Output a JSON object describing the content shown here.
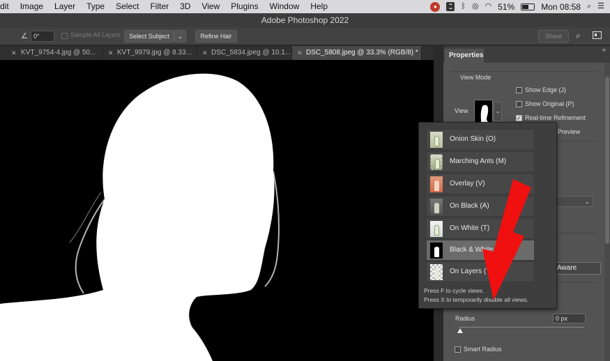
{
  "menubar": {
    "items": [
      "dit",
      "Image",
      "Layer",
      "Type",
      "Select",
      "Filter",
      "3D",
      "View",
      "Plugins",
      "Window",
      "Help"
    ],
    "battery": "51%",
    "clock": "Mon 08:58"
  },
  "title": "Adobe Photoshop 2022",
  "options_bar": {
    "angle_value": "0°",
    "sample_all_layers": "Sample All Layers",
    "select_subject": "Select Subject",
    "refine_hair": "Refine Hair",
    "share": "Share"
  },
  "tabs": [
    {
      "label": "KVT_9754-4.jpg @ 50..."
    },
    {
      "label": "KVT_9979.jpg @ 8.33..."
    },
    {
      "label": "DSC_5834.jpeg @ 10.1..."
    },
    {
      "label": "DSC_5808.jpeg @ 33.3% (RGB/8) *"
    }
  ],
  "properties": {
    "tab": "Properties",
    "view_mode": "View Mode",
    "view": "View",
    "show_edge": "Show Edge (J)",
    "show_original": "Show Original (P)",
    "realtime": "Real-time Refinement",
    "preview": "Preview",
    "content_aware": "ct Aware",
    "radius_label": "Radius",
    "radius_value": "0 px",
    "smart_radius": "Smart Radius"
  },
  "view_menu": {
    "items": [
      {
        "label": "Onion Skin (O)",
        "icon": "onion-skin-thumb"
      },
      {
        "label": "Marching Ants (M)",
        "icon": "marching-ants-thumb"
      },
      {
        "label": "Overlay (V)",
        "icon": "overlay-thumb"
      },
      {
        "label": "On Black (A)",
        "icon": "on-black-thumb"
      },
      {
        "label": "On White (T)",
        "icon": "on-white-thumb"
      },
      {
        "label": "Black & White (K)",
        "icon": "black-white-thumb"
      },
      {
        "label": "On Layers (Y)",
        "icon": "on-layers-thumb"
      }
    ],
    "selected": "Black & White (K)",
    "hint1": "Press F to cycle views.",
    "hint2": "Press X to temporarily disable all views."
  },
  "colors": {
    "annotation_arrow": "#f01010",
    "canvas_background": "#000000",
    "subject_mask": "#ffffff"
  }
}
